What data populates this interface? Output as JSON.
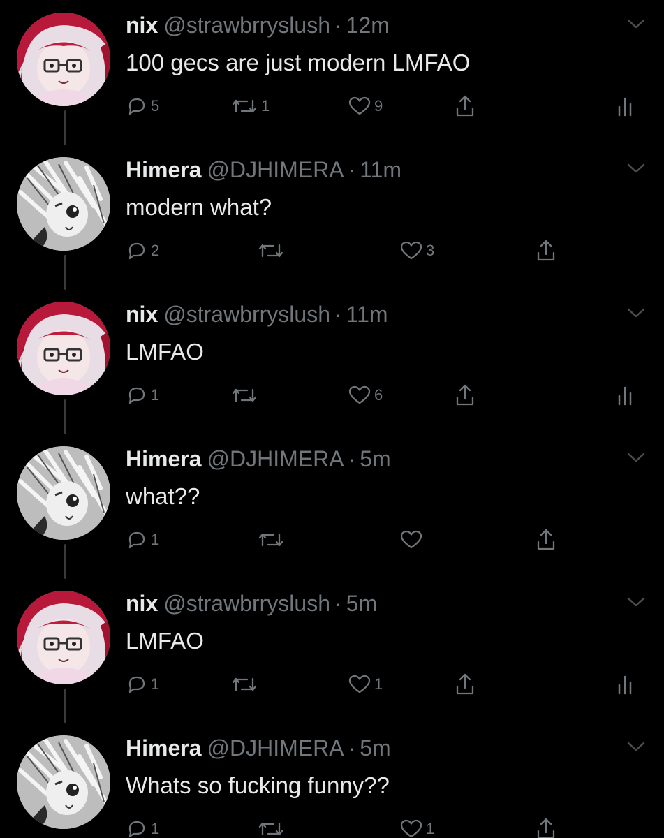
{
  "tweets": [
    {
      "name": "nix",
      "handle": "@strawbrryslush",
      "dot": "·",
      "time": "12m",
      "text": "100 gecs are just modern LMFAO",
      "reply_count": "5",
      "retweet_count": "1",
      "like_count": "9",
      "avatar": "red-hair-anime-avatar",
      "show_stats": true
    },
    {
      "name": "Himera",
      "handle": "@DJHIMERA",
      "dot": "·",
      "time": "11m",
      "text": "modern what?",
      "reply_count": "2",
      "retweet_count": "",
      "like_count": "3",
      "avatar": "white-hair-anime-avatar",
      "show_stats": false
    },
    {
      "name": "nix",
      "handle": "@strawbrryslush",
      "dot": "·",
      "time": "11m",
      "text": "LMFAO",
      "reply_count": "1",
      "retweet_count": "",
      "like_count": "6",
      "avatar": "red-hair-anime-avatar",
      "show_stats": true
    },
    {
      "name": "Himera",
      "handle": "@DJHIMERA",
      "dot": "·",
      "time": "5m",
      "text": "what??",
      "reply_count": "1",
      "retweet_count": "",
      "like_count": "",
      "avatar": "white-hair-anime-avatar",
      "show_stats": false
    },
    {
      "name": "nix",
      "handle": "@strawbrryslush",
      "dot": "·",
      "time": "5m",
      "text": "LMFAO",
      "reply_count": "1",
      "retweet_count": "",
      "like_count": "1",
      "avatar": "red-hair-anime-avatar",
      "show_stats": true
    },
    {
      "name": "Himera",
      "handle": "@DJHIMERA",
      "dot": "·",
      "time": "5m",
      "text": "Whats so fucking funny??",
      "reply_count": "1",
      "retweet_count": "",
      "like_count": "1",
      "avatar": "white-hair-anime-avatar",
      "show_stats": false
    }
  ],
  "colors": {
    "background": "#000000",
    "primary_text": "#e7e9ea",
    "secondary_text": "#71767b",
    "thread_line": "#3a3a3a"
  },
  "icons": [
    "reply-icon",
    "retweet-icon",
    "like-icon",
    "share-icon",
    "stats-icon",
    "chevron-down-icon"
  ]
}
